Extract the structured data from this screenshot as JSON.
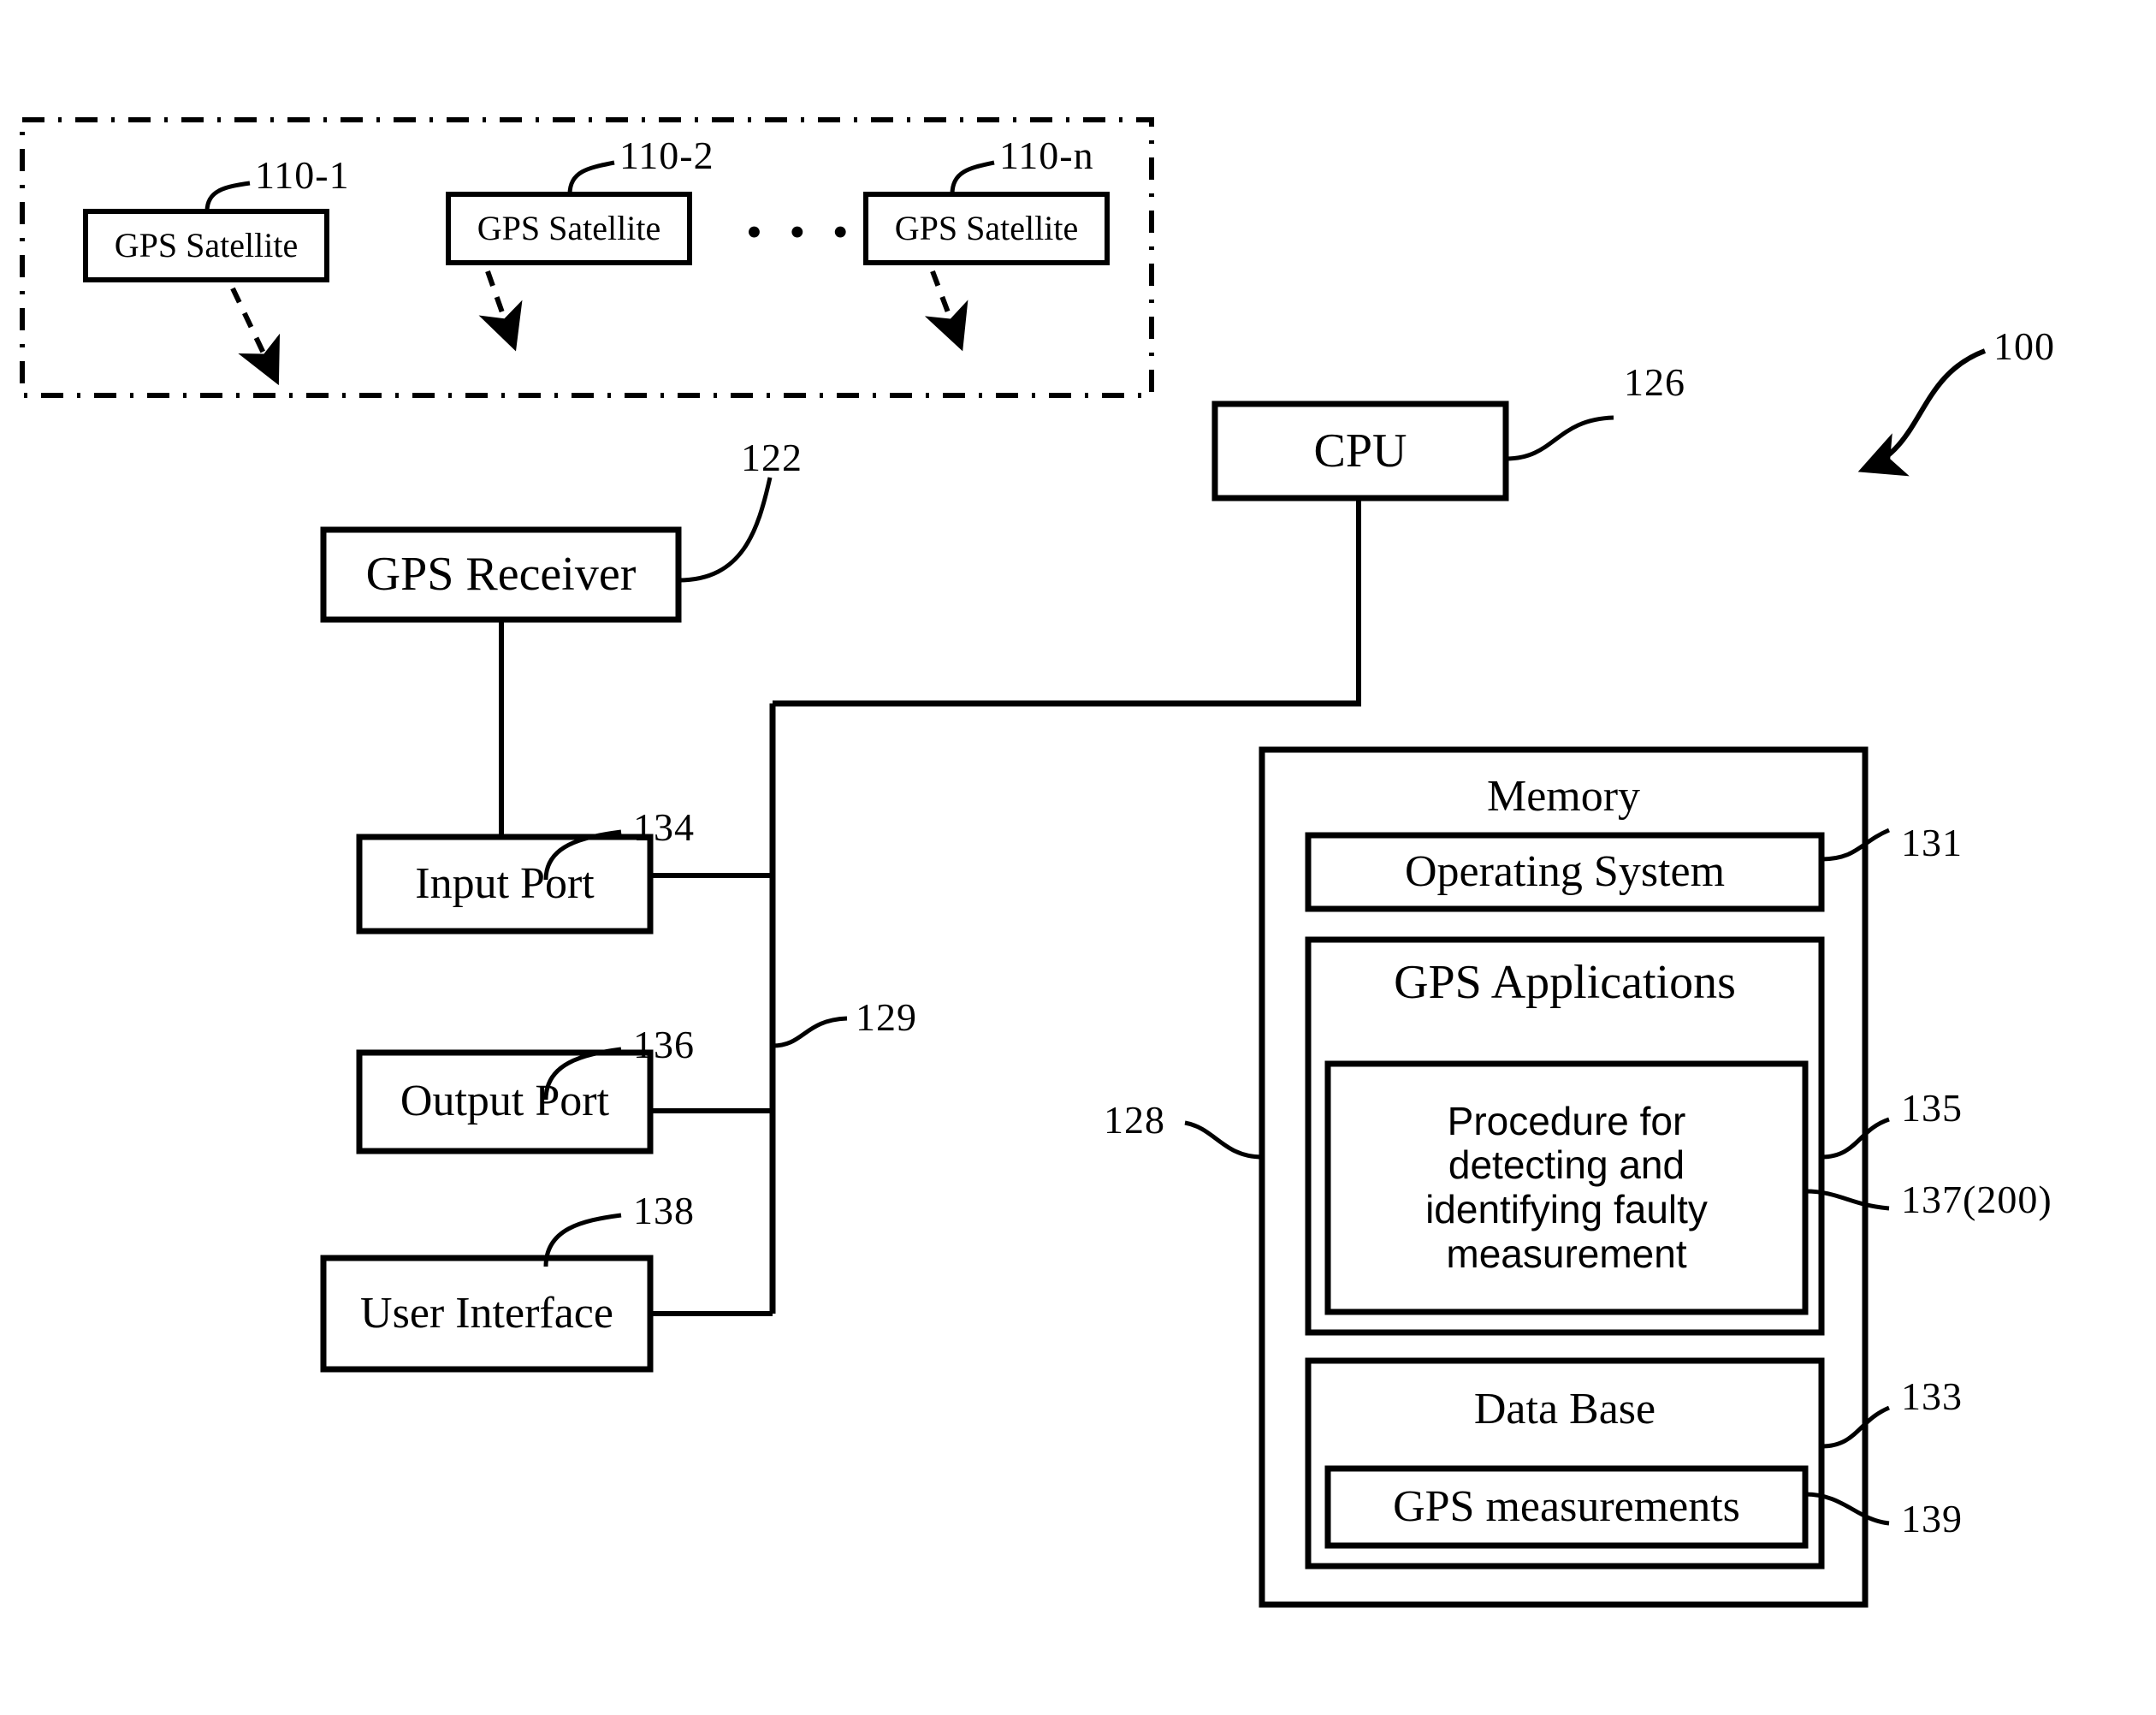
{
  "figure": {
    "system_ref": "100",
    "satellite_group": {
      "satellites": [
        {
          "label": "GPS Satellite",
          "ref": "110-1"
        },
        {
          "label": "GPS Satellite",
          "ref": "110-2"
        },
        {
          "label": "GPS Satellite",
          "ref": "110-n"
        }
      ],
      "ellipsis": "• • •"
    },
    "receiver": {
      "label": "GPS Receiver",
      "ref": "122"
    },
    "cpu": {
      "label": "CPU",
      "ref": "126"
    },
    "bus": {
      "ref": "129"
    },
    "ports": [
      {
        "label": "Input  Port",
        "ref": "134"
      },
      {
        "label": "Output Port",
        "ref": "136"
      },
      {
        "label": "User Interface",
        "ref": "138"
      }
    ],
    "memory": {
      "label": "Memory",
      "ref": "128",
      "operating_system": {
        "label": "Operating System",
        "ref": "131"
      },
      "applications": {
        "label": "GPS Applications",
        "ref": "135",
        "procedure": {
          "label": "Procedure for\ndetecting and\nidentifying faulty\nmeasurement",
          "ref": "137(200)"
        }
      },
      "database": {
        "label": "Data Base",
        "ref": "133",
        "measurements": {
          "label": "GPS measurements",
          "ref": "139"
        }
      }
    }
  }
}
